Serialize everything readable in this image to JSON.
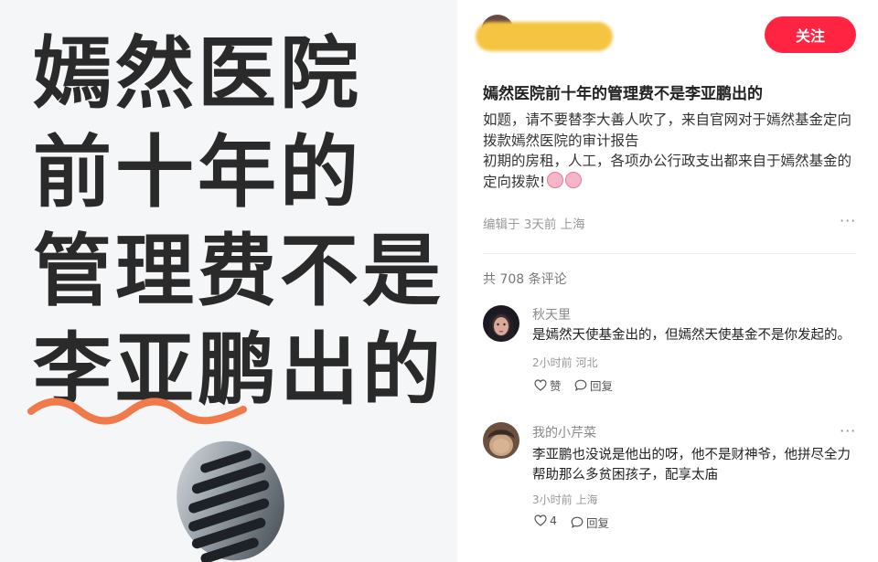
{
  "cover": {
    "line1": "嫣然医院",
    "line2": "前十年的",
    "line3": "管理费不是",
    "line4": "李亚鹏出的"
  },
  "post": {
    "follow_label": "关注",
    "title": "嫣然医院前十年的管理费不是李亚鹏出的",
    "body_paragraph1": "如题，请不要替李大善人吹了，来自官网对于嫣然基金定向拨款嫣然医院的审计报告",
    "body_paragraph2": "初期的房租，人工，各项办公行政支出都来自于嫣然基金的定向拨款!",
    "meta": "编辑于 3天前 上海",
    "more": "···",
    "comment_count": "共 708 条评论"
  },
  "comments": [
    {
      "author": "秋天里",
      "text": "是嫣然天使基金出的，但嫣然天使基金不是你发起的。",
      "meta": "2小时前 河北",
      "like_label": "赞",
      "reply_label": "回复"
    },
    {
      "author": "我的小芹菜",
      "text": "李亚鹏也没说是他出的呀，他不是财神爷，他拼尽全力帮助那么多贫困孩子，配享太庙",
      "meta": "3小时前 上海",
      "like_label": "4",
      "reply_label": "回复",
      "more": "···"
    }
  ],
  "colors": {
    "accent": "#ff2442",
    "squiggle": "#f07a4a",
    "cover_text": "#2a2a2a"
  }
}
